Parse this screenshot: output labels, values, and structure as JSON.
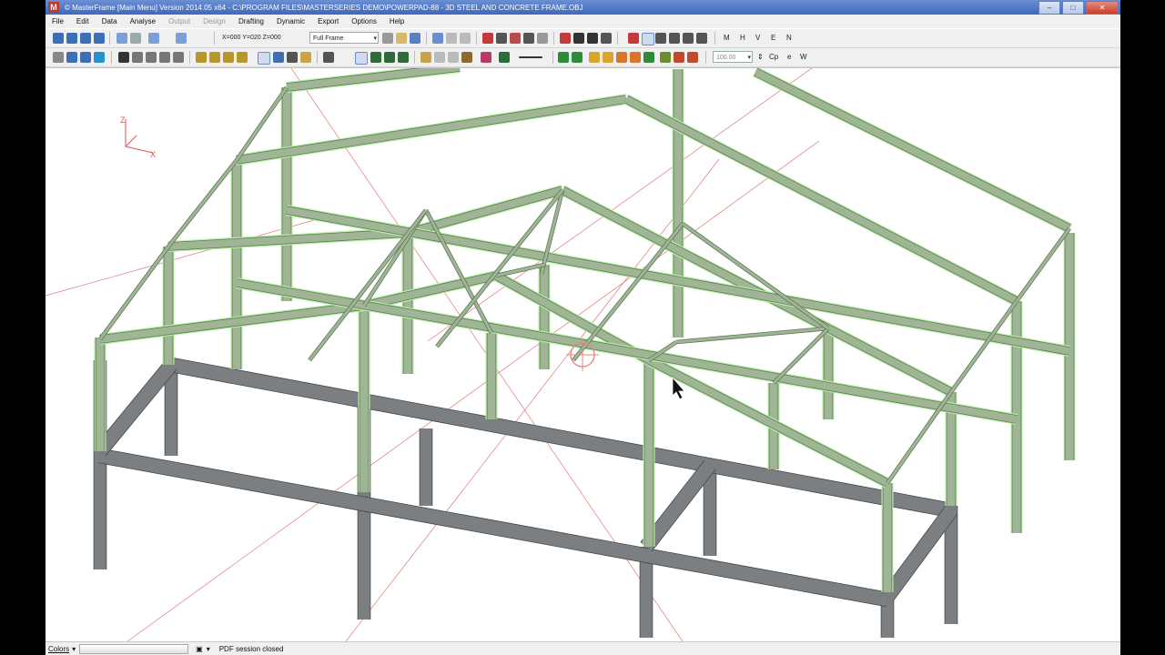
{
  "window": {
    "title": "© MasterFrame [Main Menu]  Version 2014.05 x64 - C:\\PROGRAM FILES\\MASTERSERIES DEMO\\POWERPAD-88 - 3D STEEL AND CONCRETE FRAME.OBJ",
    "app_icon": "M",
    "controls": [
      "–",
      "□",
      "✕"
    ]
  },
  "menu": [
    "File",
    "Edit",
    "Data",
    "Analyse",
    "Output",
    "Design",
    "Drafting",
    "Dynamic",
    "Export",
    "Options",
    "Help"
  ],
  "toolbar1": {
    "coords": "X=000 Y=020 Z=000",
    "view_mode": "Full Frame",
    "letters": [
      "M",
      "H",
      "V",
      "E",
      "N"
    ]
  },
  "toolbar2": {
    "zoom_value": "100.00",
    "letters": [
      "Cp",
      "e",
      "W"
    ]
  },
  "axes": {
    "z": "Z",
    "x": "X"
  },
  "status": {
    "label": "Colors",
    "message": "PDF session closed"
  },
  "colors": {
    "steel": "#9fb596",
    "steel_edge": "#5f7a57",
    "selection": "#b8f0a6",
    "concrete": "#7b7f82",
    "concrete_edge": "#45494c",
    "gridline": "#e07a78",
    "title_bar": "#4e78c8"
  }
}
